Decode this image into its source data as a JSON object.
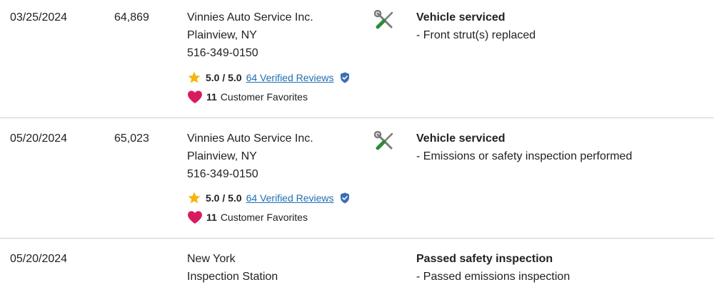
{
  "records": [
    {
      "date": "03/25/2024",
      "mileage": "64,869",
      "source": {
        "name": "Vinnies Auto Service Inc.",
        "location": "Plainview, NY",
        "phone": "516-349-0150",
        "rating": "5.0 / 5.0",
        "reviews_link": "64 Verified Reviews",
        "favorites_count": "11",
        "favorites_label": "Customer Favorites"
      },
      "icon": "wrench-screwdriver-icon",
      "details": {
        "heading": "Vehicle serviced",
        "items": [
          "- Front strut(s) replaced"
        ]
      }
    },
    {
      "date": "05/20/2024",
      "mileage": "65,023",
      "source": {
        "name": "Vinnies Auto Service Inc.",
        "location": "Plainview, NY",
        "phone": "516-349-0150",
        "rating": "5.0 / 5.0",
        "reviews_link": "64 Verified Reviews",
        "favorites_count": "11",
        "favorites_label": "Customer Favorites"
      },
      "icon": "wrench-screwdriver-icon",
      "details": {
        "heading": "Vehicle serviced",
        "items": [
          "- Emissions or safety inspection performed"
        ]
      }
    },
    {
      "date": "05/20/2024",
      "mileage": "",
      "source": {
        "name": "New York",
        "location": "Inspection Station"
      },
      "details": {
        "heading": "Passed safety inspection",
        "items": [
          "- Passed emissions inspection"
        ]
      }
    }
  ],
  "colors": {
    "star": "#f5b50a",
    "heart": "#d81b60",
    "link": "#1f6fb2",
    "verified_shield": "#3b6fb5",
    "tool_grey": "#7a7a7a",
    "tool_green": "#2e8b3a",
    "divider": "#cfcfcf"
  }
}
